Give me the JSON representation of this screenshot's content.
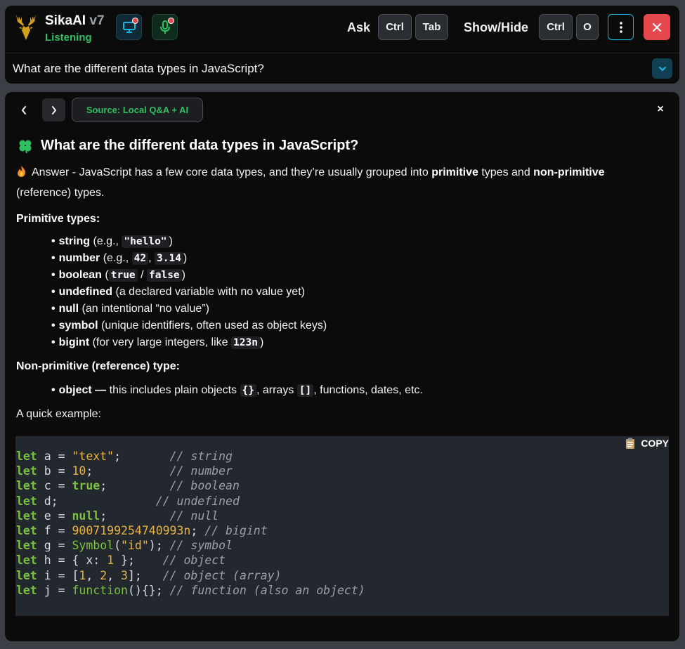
{
  "app": {
    "name": "SikaAI",
    "version": "v7",
    "status": "Listening"
  },
  "shortcuts": {
    "ask_label": "Ask",
    "ask_keys": [
      "Ctrl",
      "Tab"
    ],
    "toggle_label": "Show/Hide",
    "toggle_keys": [
      "Ctrl",
      "O"
    ]
  },
  "colors": {
    "status_green": "#2fbf5f",
    "accent_cyan": "#16b8e0",
    "close_red": "#e5484d"
  },
  "question_bar": {
    "text": "What are the different data types in JavaScript?"
  },
  "answer_header": {
    "source": "Source: Local Q&A + AI",
    "close": "×"
  },
  "answer": {
    "title": "What are the different data types in JavaScript?",
    "intro_pre": "Answer - JavaScript has a few core data types, and they’re usually grouped into ",
    "intro_b1": "primitive",
    "intro_mid": " types and ",
    "intro_b2": "non-primitive",
    "intro_post": " (reference) types.",
    "primitive_heading": "Primitive types:",
    "primitive_items": {
      "string": {
        "name": "string",
        "pre": " (e.g., ",
        "code": "\"hello\"",
        "post": ")"
      },
      "number": {
        "name": "number",
        "pre": " (e.g., ",
        "code1": "42",
        "sep": ", ",
        "code2": "3.14",
        "post": ")"
      },
      "boolean": {
        "name": "boolean",
        "pre": " (",
        "code1": "true",
        "sep": " / ",
        "code2": "false",
        "post": ")"
      },
      "undefined": {
        "name": "undefined",
        "post": " (a declared variable with no value yet)"
      },
      "null": {
        "name": "null",
        "post": " (an intentional “no value”)"
      },
      "symbol": {
        "name": "symbol",
        "post": " (unique identifiers, often used as object keys)"
      },
      "bigint": {
        "name": "bigint",
        "pre": " (for very large integers, like ",
        "code": "123n",
        "post": ")"
      }
    },
    "nonprimitive_heading": "Non-primitive (reference) type:",
    "object_item": {
      "name": "object —",
      "pre": " this includes plain objects ",
      "code1": "{}",
      "mid": ", arrays ",
      "code2": "[]",
      "post": ", functions, dates, etc."
    },
    "example_label": "A quick example:",
    "copy_label": "COPY",
    "code": {
      "l1": {
        "kw": "let",
        "body": " a = ",
        "val": "\"text\"",
        "pad": ";       ",
        "cm": "// string"
      },
      "l2": {
        "kw": "let",
        "body": " b = ",
        "val": "10",
        "pad": ";           ",
        "cm": "// number"
      },
      "l3": {
        "kw": "let",
        "body": " c = ",
        "val": "true",
        "pad": ";         ",
        "cm": "// boolean"
      },
      "l4": {
        "kw": "let",
        "body": " d;",
        "pad": "              ",
        "cm": "// undefined"
      },
      "l5": {
        "kw": "let",
        "body": " e = ",
        "val": "null",
        "pad": ";         ",
        "cm": "// null"
      },
      "l6": {
        "kw": "let",
        "body": " f = ",
        "val": "9007199254740993n",
        "pad": "; ",
        "cm": "// bigint"
      },
      "l7": {
        "kw": "let",
        "body": " g = ",
        "fn": "Symbol",
        "open": "(",
        "val": "\"id\"",
        "close": ");",
        "pad": " ",
        "cm": "// symbol"
      },
      "l8": {
        "kw": "let",
        "body": " h = { x: ",
        "val": "1",
        "close": " };",
        "pad": "    ",
        "cm": "// object"
      },
      "l9": {
        "kw": "let",
        "body": " i = [",
        "v1": "1",
        "s1": ", ",
        "v2": "2",
        "s2": ", ",
        "v3": "3",
        "close": "];",
        "pad": "   ",
        "cm": "// object (array)"
      },
      "l10": {
        "kw": "let",
        "body": " j = ",
        "fn": "function",
        "close": "(){};",
        "pad": " ",
        "cm": "// function (also an object)"
      }
    }
  }
}
